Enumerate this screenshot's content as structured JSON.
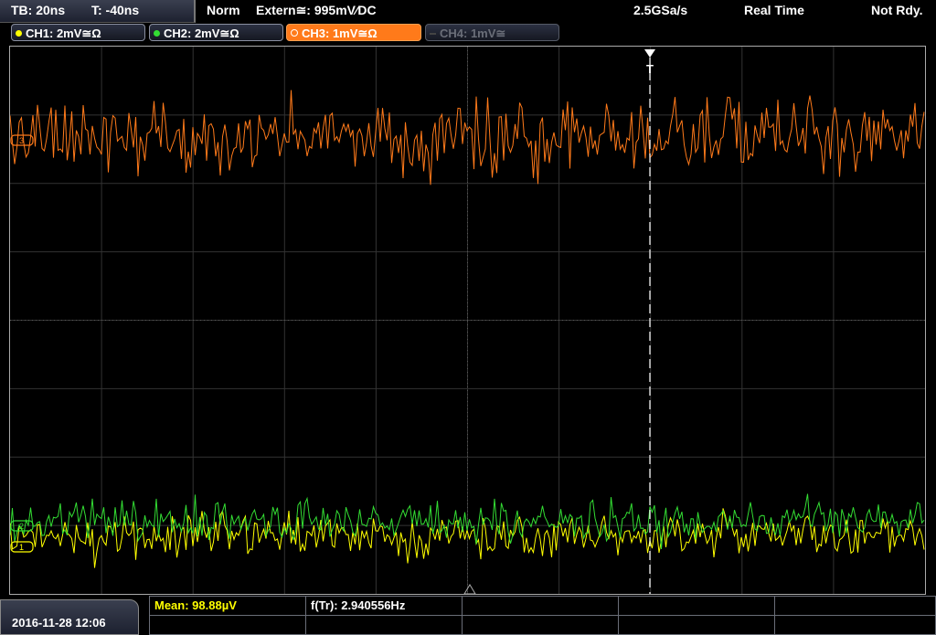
{
  "header": {
    "timebase": "TB: 20ns",
    "trigger_time": "T: -40ns",
    "mode": "Norm",
    "trigger_source": "Extern≅: 995mV∕DC",
    "sample_rate": "2.5GSa/s",
    "acq_mode": "Real Time",
    "status": "Not Rdy."
  },
  "channels": [
    {
      "label": "CH1: 2mV≅Ω",
      "color": "#ffff00",
      "state": "normal"
    },
    {
      "label": "CH2: 2mV≅Ω",
      "color": "#33dd33",
      "state": "normal"
    },
    {
      "label": "CH3: 1mV≅Ω",
      "color": "#ff7a1a",
      "state": "active"
    },
    {
      "label": "CH4: 1mV≅",
      "color": "#555555",
      "state": "off"
    }
  ],
  "markers": {
    "ch3": "3",
    "ch2": "2",
    "ch1": "1",
    "trigger": "T"
  },
  "footer": {
    "datetime": "2016-11-28 12:06",
    "mean": "Mean: 98.88µV",
    "freq": "f(Tr): 2.940556Hz"
  },
  "colors": {
    "ch1": "#ffff00",
    "ch2": "#33dd33",
    "ch3": "#ff7a1a",
    "grid": "#333333"
  }
}
